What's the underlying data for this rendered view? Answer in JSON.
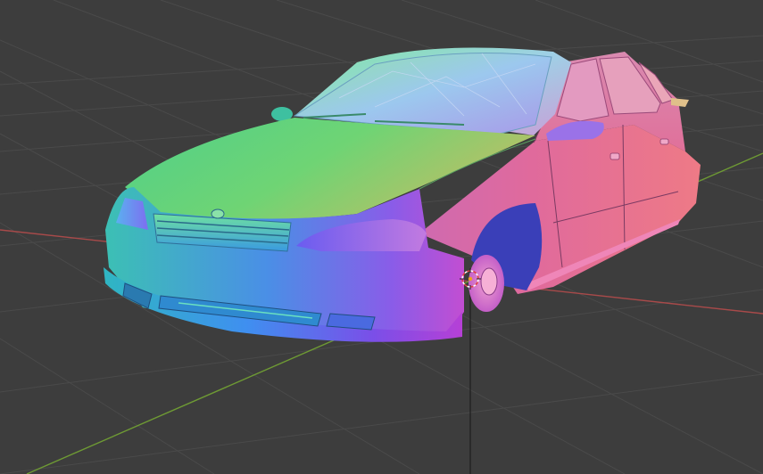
{
  "viewport": {
    "background_color": "#3d3d3d",
    "grid_color": "#4a4a4a",
    "grid_visible": true,
    "axis_x_color": "#a84a4a",
    "axis_y_color": "#6e9a34",
    "axis_z_color": "#1f1f1f",
    "shading_mode": "normal-map",
    "object_icon": "car-icon",
    "origin_icon": "3d-cursor-icon"
  }
}
